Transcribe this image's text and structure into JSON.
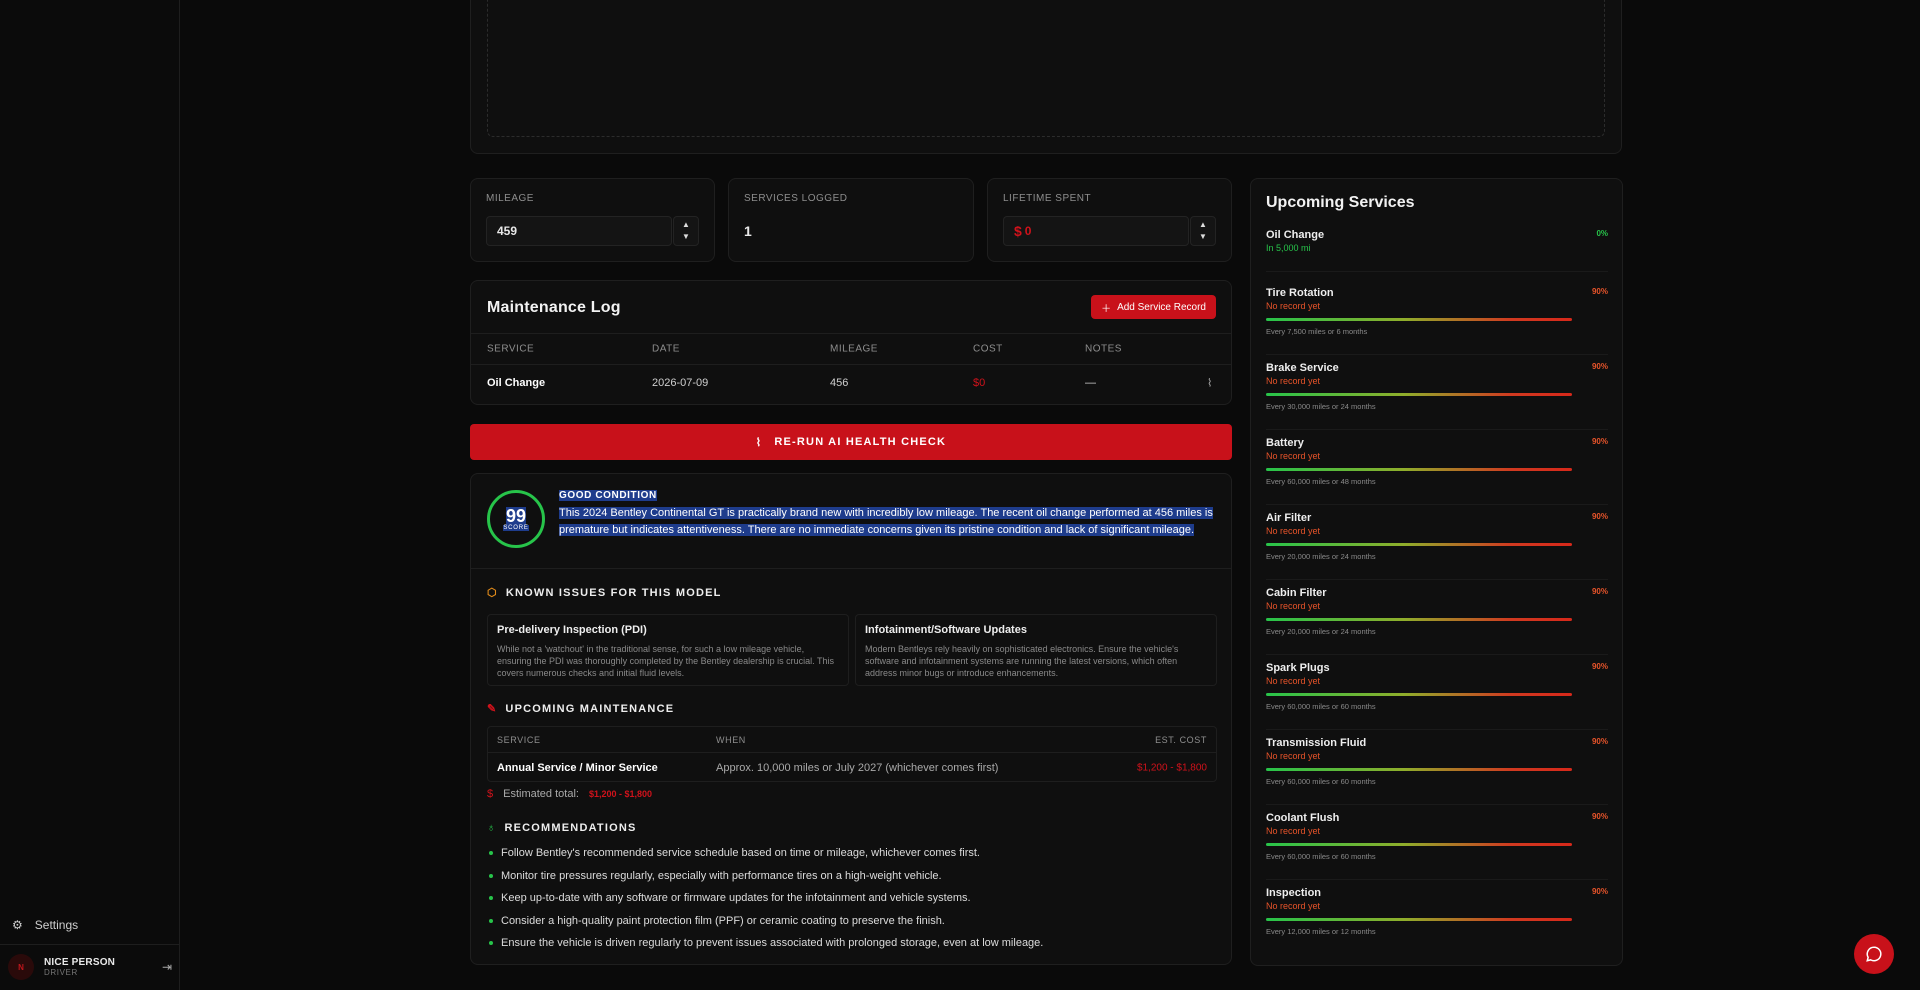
{
  "sidebar": {
    "settings_label": "Settings",
    "user_initials": "N",
    "user_name": "NICE PERSON",
    "user_role": "DRIVER"
  },
  "stats": {
    "mileage_label": "MILEAGE",
    "mileage_value": "459",
    "services_label": "SERVICES LOGGED",
    "services_value": "1",
    "lifetime_label": "LIFETIME SPENT",
    "lifetime_currency": "$",
    "lifetime_value": "0"
  },
  "log": {
    "title": "Maintenance Log",
    "add_button": "Add Service Record",
    "columns": [
      "SERVICE",
      "DATE",
      "MILEAGE",
      "COST",
      "NOTES"
    ],
    "rows": [
      {
        "service": "Oil Change",
        "date": "2026-07-09",
        "mileage": "456",
        "cost": "$0",
        "notes": "—"
      }
    ]
  },
  "rerun_label": "RE-RUN AI HEALTH CHECK",
  "health": {
    "score": "99",
    "score_label": "SCORE",
    "condition": "GOOD CONDITION",
    "summary": "This 2024 Bentley Continental GT is practically brand new with incredibly low mileage. The recent oil change performed at 456 miles is premature but indicates attentiveness. There are no immediate concerns given its pristine condition and lack of significant mileage.",
    "known_title": "KNOWN ISSUES FOR THIS MODEL",
    "issues": [
      {
        "title": "Pre-delivery Inspection (PDI)",
        "text": "While not a 'watchout' in the traditional sense, for such a low mileage vehicle, ensuring the PDI was thoroughly completed by the Bentley dealership is crucial. This covers numerous checks and initial fluid levels."
      },
      {
        "title": "Infotainment/Software Updates",
        "text": "Modern Bentleys rely heavily on sophisticated electronics. Ensure the vehicle's software and infotainment systems are running the latest versions, which often address minor bugs or introduce enhancements."
      }
    ],
    "upcoming_title": "UPCOMING MAINTENANCE",
    "upcoming_columns": [
      "SERVICE",
      "WHEN",
      "EST. COST"
    ],
    "upcoming_rows": [
      {
        "service": "Annual Service / Minor Service",
        "when": "Approx. 10,000 miles or July 2027 (whichever comes first)",
        "cost": "$1,200 - $1,800"
      }
    ],
    "estimated_label": "Estimated total:",
    "estimated_value": "$1,200 - $1,800",
    "recommendations_title": "RECOMMENDATIONS",
    "recommendations": [
      "Follow Bentley's recommended service schedule based on time or mileage, whichever comes first.",
      "Monitor tire pressures regularly, especially with performance tires on a high-weight vehicle.",
      "Keep up-to-date with any software or firmware updates for the infotainment and vehicle systems.",
      "Consider a high-quality paint protection film (PPF) or ceramic coating to preserve the finish.",
      "Ensure the vehicle is driven regularly to prevent issues associated with prolonged storage, even at low mileage."
    ]
  },
  "upcoming": {
    "title": "Upcoming Services",
    "first": {
      "name": "Oil Change",
      "status": "In 5,000 mi",
      "pct": "0%"
    },
    "items": [
      {
        "name": "Tire Rotation",
        "status": "No record yet",
        "pct": "90%",
        "note": "Every 7,500 miles or 6 months"
      },
      {
        "name": "Brake Service",
        "status": "No record yet",
        "pct": "90%",
        "note": "Every 30,000 miles or 24 months"
      },
      {
        "name": "Battery",
        "status": "No record yet",
        "pct": "90%",
        "note": "Every 60,000 miles or 48 months"
      },
      {
        "name": "Air Filter",
        "status": "No record yet",
        "pct": "90%",
        "note": "Every 20,000 miles or 24 months"
      },
      {
        "name": "Cabin Filter",
        "status": "No record yet",
        "pct": "90%",
        "note": "Every 20,000 miles or 24 months"
      },
      {
        "name": "Spark Plugs",
        "status": "No record yet",
        "pct": "90%",
        "note": "Every 60,000 miles or 60 months"
      },
      {
        "name": "Transmission Fluid",
        "status": "No record yet",
        "pct": "90%",
        "note": "Every 60,000 miles or 60 months"
      },
      {
        "name": "Coolant Flush",
        "status": "No record yet",
        "pct": "90%",
        "note": "Every 60,000 miles or 60 months"
      },
      {
        "name": "Inspection",
        "status": "No record yet",
        "pct": "90%",
        "note": "Every 12,000 miles or 12 months"
      }
    ]
  },
  "colors": {
    "accent": "#c8111a",
    "good": "#27c44a",
    "selection": "#1e3c8c"
  }
}
